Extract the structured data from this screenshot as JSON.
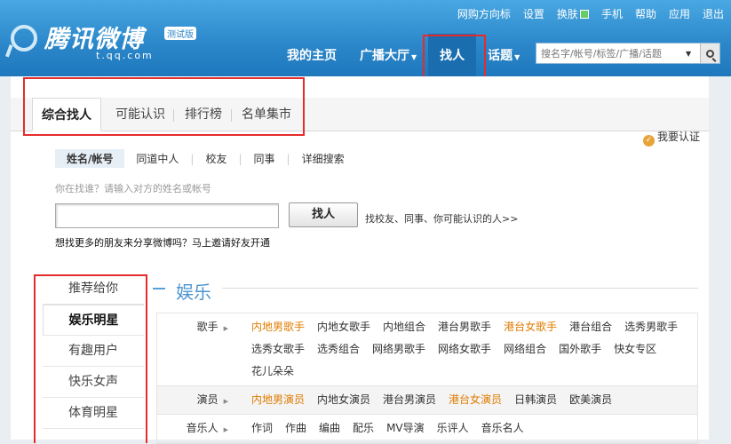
{
  "header": {
    "top_links": [
      "网购方向标",
      "设置",
      "换肤",
      "手机",
      "帮助",
      "应用",
      "退出"
    ],
    "logo": {
      "name": "腾讯微博",
      "badge": "测试版",
      "url": "t.qq.com"
    },
    "nav": [
      {
        "label": "我的主页",
        "caret": false,
        "active": false
      },
      {
        "label": "广播大厅",
        "caret": true,
        "active": false
      },
      {
        "label": "找人",
        "caret": false,
        "active": true
      },
      {
        "label": "话题",
        "caret": true,
        "active": false
      }
    ],
    "search_placeholder": "搜名字/帐号/标签/广播/话题"
  },
  "tabs": {
    "items": [
      "综合找人",
      "可能认识",
      "排行榜",
      "名单集市"
    ],
    "active": "综合找人",
    "verify_label": "我要认证"
  },
  "search": {
    "types": [
      "姓名/帐号",
      "同道中人",
      "校友",
      "同事",
      "详细搜索"
    ],
    "active_type": "姓名/帐号",
    "hint": "你在找谁？请输入对方的姓名或帐号",
    "input_value": "",
    "button": "找人",
    "more_link": "找校友、同事、你可能认识的人>>",
    "invite": "想找更多的朋友来分享微博吗？马上邀请好友开通"
  },
  "left_nav": {
    "items": [
      "推荐给你",
      "娱乐明星",
      "有趣用户",
      "快乐女声",
      "体育明星"
    ],
    "active": "娱乐明星"
  },
  "category": {
    "title": "娱乐",
    "rows": [
      {
        "label": "歌手",
        "items": [
          {
            "text": "内地男歌手",
            "hot": true
          },
          {
            "text": "内地女歌手",
            "hot": false
          },
          {
            "text": "内地组合",
            "hot": false
          },
          {
            "text": "港台男歌手",
            "hot": false
          },
          {
            "text": "港台女歌手",
            "hot": true
          },
          {
            "text": "港台组合",
            "hot": false
          },
          {
            "text": "选秀男歌手",
            "hot": false
          },
          {
            "text": "选秀女歌手",
            "hot": false
          },
          {
            "text": "选秀组合",
            "hot": false
          },
          {
            "text": "网络男歌手",
            "hot": false
          },
          {
            "text": "网络女歌手",
            "hot": false
          },
          {
            "text": "网络组合",
            "hot": false
          },
          {
            "text": "国外歌手",
            "hot": false
          },
          {
            "text": "快女专区",
            "hot": false
          },
          {
            "text": "花儿朵朵",
            "hot": false
          }
        ]
      },
      {
        "label": "演员",
        "items": [
          {
            "text": "内地男演员",
            "hot": true
          },
          {
            "text": "内地女演员",
            "hot": false
          },
          {
            "text": "港台男演员",
            "hot": false
          },
          {
            "text": "港台女演员",
            "hot": true
          },
          {
            "text": "日韩演员",
            "hot": false
          },
          {
            "text": "欧美演员",
            "hot": false
          }
        ]
      },
      {
        "label": "音乐人",
        "items": [
          {
            "text": "作词",
            "hot": false
          },
          {
            "text": "作曲",
            "hot": false
          },
          {
            "text": "编曲",
            "hot": false
          },
          {
            "text": "配乐",
            "hot": false
          },
          {
            "text": "MV导演",
            "hot": false
          },
          {
            "text": "乐评人",
            "hot": false
          },
          {
            "text": "音乐名人",
            "hot": false
          }
        ]
      }
    ]
  },
  "colors": {
    "header": "#2a86c9",
    "highlight": "#e52b2b",
    "hot_link": "#e07b00",
    "accent": "#4b94cf"
  }
}
